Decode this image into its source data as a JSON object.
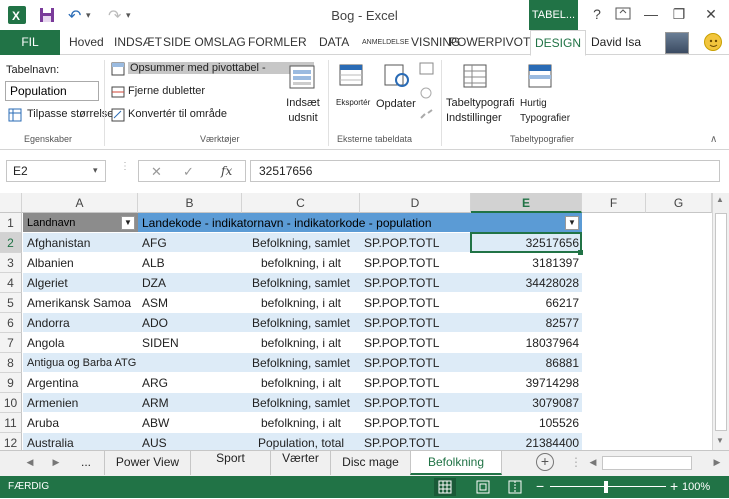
{
  "window": {
    "title": "Bog - Excel",
    "context_tab": "TABEL...",
    "help": "?",
    "minimize": "—",
    "restore": "❐",
    "close": "✕",
    "quick_access": {
      "undo": "↶",
      "redo": "↷"
    }
  },
  "ribbon_tabs": {
    "file": "FIL",
    "tabs": [
      "Hoved",
      "INDSÆT",
      "SIDE OMSLAG",
      "FORMLER",
      "DATA",
      "ANMELDELSE",
      "VISNING",
      "POWERPIVOT",
      "DESIGN"
    ],
    "user": "David Isa"
  },
  "ribbon": {
    "tablename_label": "Tabelnavn:",
    "tablename_value": "Population",
    "resize_label": "Tilpasse størrelsen",
    "group_properties": "Egenskaber",
    "summarize_label": "Opsummer med pivottabel -",
    "remove_duplicates": "Fjerne dubletter",
    "convert_range": "Konvertér til område",
    "insert_slicer": "Indsæt udsnit",
    "group_tools": "Værktøjer",
    "export_label": "Eksportér",
    "refresh_label": "Opdater",
    "group_external": "Eksterne tabeldata",
    "table_style_options": "Tabeltypografi Indstillinger",
    "quick_styles": "Hurtig Typografier",
    "group_styles": "Tabeltypografier"
  },
  "formula_bar": {
    "namebox": "E2",
    "formula": "32517656",
    "cancel": "✕",
    "enter": "✓",
    "fx": "fx"
  },
  "columns": [
    "A",
    "B",
    "C",
    "D",
    "E",
    "F",
    "G"
  ],
  "header_row": {
    "row": "1",
    "a": "Landnavn",
    "b": "Landekode - indikatornavn - indikatorkode - population"
  },
  "rows": [
    {
      "n": "2",
      "country": "Afghanistan",
      "code": "AFG",
      "indicator": "Befolkning, samlet",
      "icode": "SP.POP.TOTL",
      "value": "32517656"
    },
    {
      "n": "3",
      "country": "Albanien",
      "code": "ALB",
      "indicator": "befolkning, i alt",
      "icode": "SP.POP.TOTL",
      "value": "3181397"
    },
    {
      "n": "4",
      "country": "Algeriet",
      "code": "DZA",
      "indicator": "Befolkning, samlet",
      "icode": "SP.POP.TOTL",
      "value": "34428028"
    },
    {
      "n": "5",
      "country": "Amerikansk Samoa",
      "code": "ASM",
      "indicator": "befolkning, i alt",
      "icode": "SP.POP.TOTL",
      "value": "66217"
    },
    {
      "n": "6",
      "country": "Andorra",
      "code": "ADO",
      "indicator": "Befolkning, samlet",
      "icode": "SP.POP.TOTL",
      "value": "82577"
    },
    {
      "n": "7",
      "country": "Angola",
      "code": "SIDEN",
      "indicator": "befolkning, i alt",
      "icode": "SP.POP.TOTL",
      "value": "18037964"
    },
    {
      "n": "8",
      "country": "Antigua og Barba ATG",
      "code": "",
      "indicator": "Befolkning, samlet",
      "icode": "SP.POP.TOTL",
      "value": "86881"
    },
    {
      "n": "9",
      "country": "Argentina",
      "code": "ARG",
      "indicator": "befolkning, i alt",
      "icode": "SP.POP.TOTL",
      "value": "39714298"
    },
    {
      "n": "10",
      "country": "Armenien",
      "code": "ARM",
      "indicator": "Befolkning, samlet",
      "icode": "SP.POP.TOTL",
      "value": "3079087"
    },
    {
      "n": "11",
      "country": "Aruba",
      "code": "ABW",
      "indicator": "befolkning, i alt",
      "icode": "SP.POP.TOTL",
      "value": "105526"
    },
    {
      "n": "12",
      "country": "Australia",
      "code": "AUS",
      "indicator": "Population, total",
      "icode": "SP.POP.TOTL",
      "value": "21384400"
    }
  ],
  "sheet_tabs": {
    "prev": "◀",
    "next": "▶",
    "more": "...",
    "tabs": [
      "Power View",
      "Sport",
      "Værter",
      "Disc mage",
      "Befolkning"
    ],
    "add": "+"
  },
  "status": {
    "ready": "FÆRDIG",
    "zoom": "100%",
    "minus": "−",
    "plus": "+"
  },
  "colors": {
    "excel_green": "#217346",
    "table_header": "#5b9bd5",
    "band_light": "#ddebf7"
  }
}
